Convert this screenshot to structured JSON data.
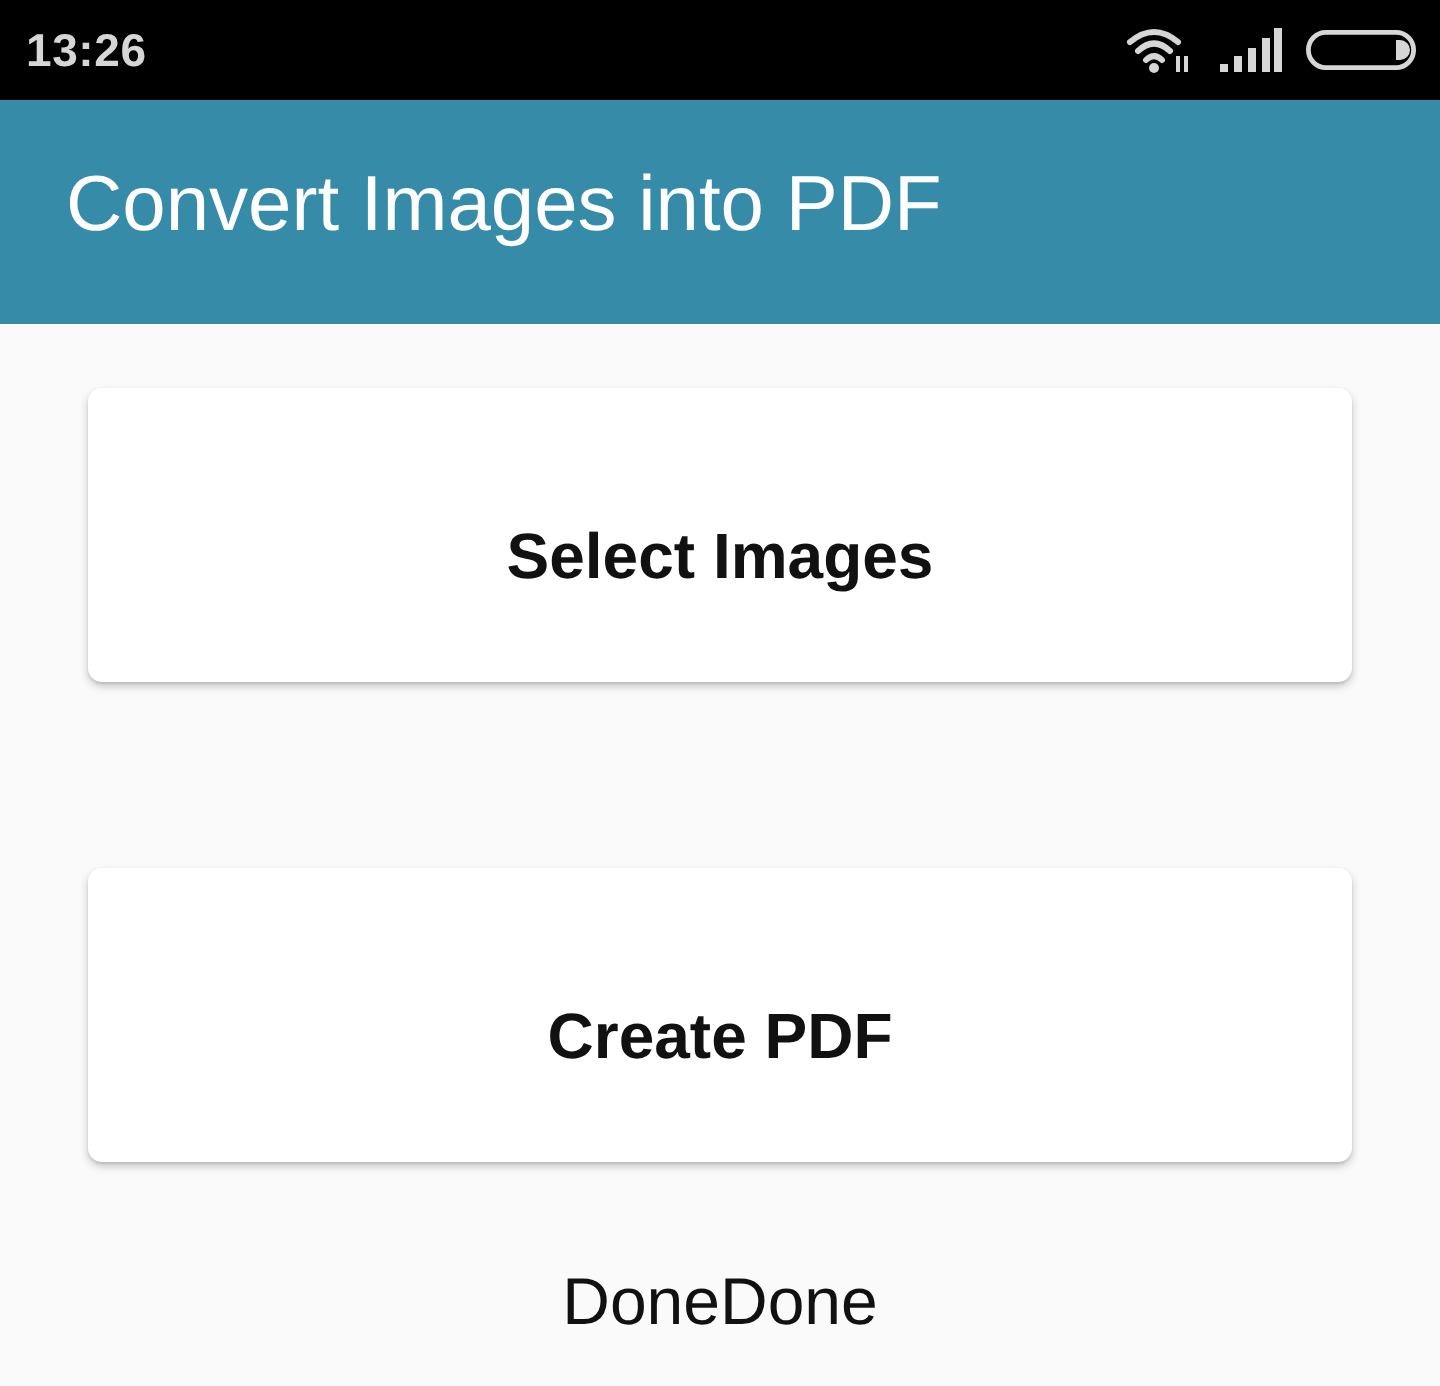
{
  "status_bar": {
    "time": "13:26"
  },
  "app_bar": {
    "title": "Convert Images into PDF"
  },
  "buttons": [
    {
      "label": "Select Images"
    },
    {
      "label": "Create PDF"
    }
  ],
  "status_text": "DoneDone"
}
